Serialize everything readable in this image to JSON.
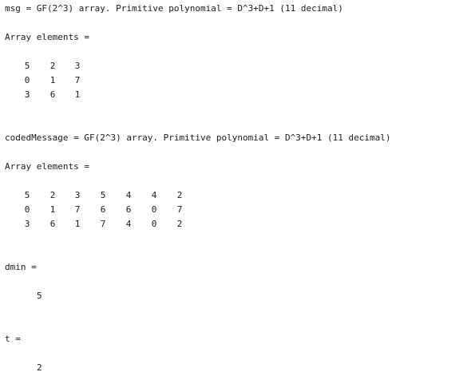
{
  "msg": {
    "header": "msg = GF(2^3) array. Primitive polynomial = D^3+D+1 (11 decimal)",
    "elements_label": "Array elements =",
    "rows": [
      [
        "5",
        "2",
        "3"
      ],
      [
        "0",
        "1",
        "7"
      ],
      [
        "3",
        "6",
        "1"
      ]
    ]
  },
  "codedMessage": {
    "header": "codedMessage = GF(2^3) array. Primitive polynomial = D^3+D+1 (11 decimal)",
    "elements_label": "Array elements =",
    "rows": [
      [
        "5",
        "2",
        "3",
        "5",
        "4",
        "4",
        "2"
      ],
      [
        "0",
        "1",
        "7",
        "6",
        "6",
        "0",
        "7"
      ],
      [
        "3",
        "6",
        "1",
        "7",
        "4",
        "0",
        "2"
      ]
    ]
  },
  "dmin": {
    "label": "dmin =",
    "value": "5"
  },
  "t": {
    "label": "t =",
    "value": "2"
  }
}
